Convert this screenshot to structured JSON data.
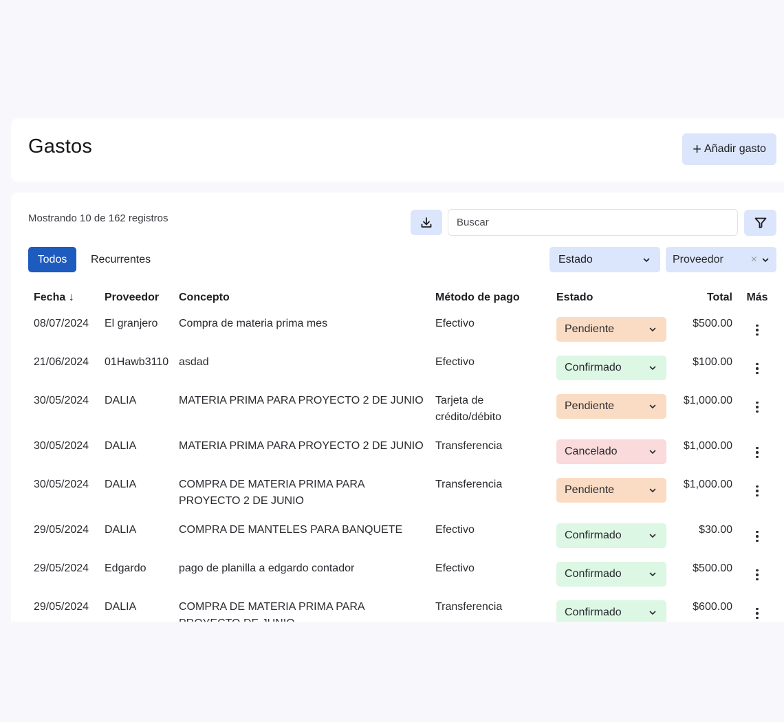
{
  "header": {
    "title": "Gastos",
    "add_button_label": "Añadir gasto"
  },
  "toolbar": {
    "records_count": "Mostrando 10 de 162 registros",
    "search_placeholder": "Buscar",
    "download_icon": "download-icon",
    "filter_icon": "filter-icon"
  },
  "tabs": [
    {
      "label": "Todos",
      "active": true
    },
    {
      "label": "Recurrentes",
      "active": false
    }
  ],
  "filters": {
    "estado_label": "Estado",
    "proveedor_label": "Proveedor"
  },
  "table": {
    "columns": [
      "Fecha ↓",
      "Proveedor",
      "Concepto",
      "Método de pago",
      "Estado",
      "Total",
      "Más"
    ],
    "rows": [
      {
        "fecha": "08/07/2024",
        "proveedor": "El granjero",
        "concepto": "Compra de materia prima mes",
        "metodo": "Efectivo",
        "estado": "Pendiente",
        "total": "$500.00"
      },
      {
        "fecha": "21/06/2024",
        "proveedor": "01Hawb3110",
        "concepto": "asdad",
        "metodo": "Efectivo",
        "estado": "Confirmado",
        "total": "$100.00"
      },
      {
        "fecha": "30/05/2024",
        "proveedor": "DALIA",
        "concepto": "MATERIA PRIMA PARA PROYECTO 2 DE JUNIO",
        "metodo": "Tarjeta de crédito/débito",
        "estado": "Pendiente",
        "total": "$1,000.00"
      },
      {
        "fecha": "30/05/2024",
        "proveedor": "DALIA",
        "concepto": "MATERIA PRIMA PARA PROYECTO 2 DE JUNIO",
        "metodo": "Transferencia",
        "estado": "Cancelado",
        "total": "$1,000.00"
      },
      {
        "fecha": "30/05/2024",
        "proveedor": "DALIA",
        "concepto": "COMPRA DE MATERIA PRIMA PARA PROYECTO 2 DE JUNIO",
        "metodo": "Transferencia",
        "estado": "Pendiente",
        "total": "$1,000.00"
      },
      {
        "fecha": "29/05/2024",
        "proveedor": "DALIA",
        "concepto": "COMPRA DE MANTELES PARA BANQUETE",
        "metodo": "Efectivo",
        "estado": "Confirmado",
        "total": "$30.00"
      },
      {
        "fecha": "29/05/2024",
        "proveedor": "Edgardo",
        "concepto": "pago de planilla a edgardo contador",
        "metodo": "Efectivo",
        "estado": "Confirmado",
        "total": "$500.00"
      },
      {
        "fecha": "29/05/2024",
        "proveedor": "DALIA",
        "concepto": "COMPRA DE MATERIA PRIMA PARA PROYECTO DE JUNIO",
        "metodo": "Transferencia",
        "estado": "Confirmado",
        "total": "$600.00"
      }
    ]
  },
  "colors": {
    "primary": "#1d5bbf",
    "secondary_button": "#dbe5fb",
    "pendiente": "#fadcc4",
    "confirmado": "#dcf7e3",
    "cancelado": "#fadada"
  }
}
